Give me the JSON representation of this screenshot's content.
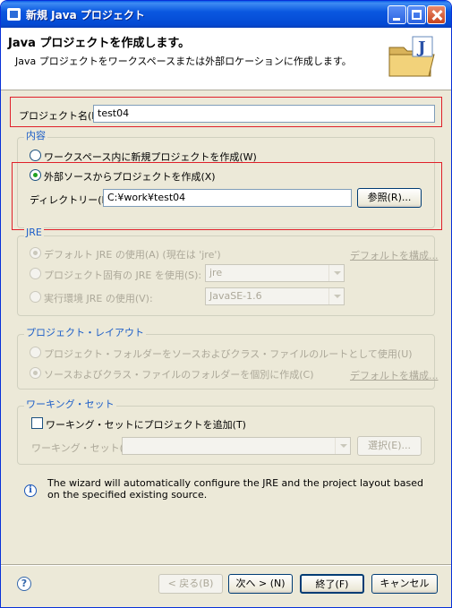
{
  "window": {
    "title": "新規 Java プロジェクト"
  },
  "banner": {
    "title": "Java プロジェクトを作成します。",
    "description": "Java プロジェクトをワークスペースまたは外部ロケーションに作成します。"
  },
  "project_name": {
    "label": "プロジェクト名(P):",
    "value": "test04"
  },
  "contents": {
    "title": "内容",
    "option_workspace": "ワークスペース内に新規プロジェクトを作成(W)",
    "option_external": "外部ソースからプロジェクトを作成(X)",
    "directory_label": "ディレクトリー(D):",
    "directory_value": "C:¥work¥test04",
    "browse_button": "参照(R)..."
  },
  "jre": {
    "title": "JRE",
    "option_default": "デフォルト JRE の使用(A) (現在は 'jre')",
    "default_link": "デフォルトを構成...",
    "option_project": "プロジェクト固有の JRE を使用(S):",
    "project_value": "jre",
    "option_env": "実行環境 JRE の使用(V):",
    "env_value": "JavaSE-1.6"
  },
  "layout": {
    "title": "プロジェクト・レイアウト",
    "option_root": "プロジェクト・フォルダーをソースおよびクラス・ファイルのルートとして使用(U)",
    "option_separate": "ソースおよびクラス・ファイルのフォルダーを個別に作成(C)",
    "default_link": "デフォルトを構成..."
  },
  "working_set": {
    "title": "ワーキング・セット",
    "add_label": "ワーキング・セットにプロジェクトを追加(T)",
    "set_label": "ワーキング・セット(O):",
    "select_button": "選択(E)..."
  },
  "info": {
    "message": "The wizard will automatically configure the JRE and the project layout based on the specified existing source."
  },
  "buttons": {
    "help_symbol": "?",
    "back": "< 戻る(B)",
    "next": "次へ > (N)",
    "finish": "終了(F)",
    "cancel": "キャンセル"
  },
  "icons": {
    "window_icon": "java-app-icon",
    "banner_icon": "java-project-folder-icon",
    "info_icon": "info-icon",
    "help_icon": "help-icon"
  },
  "colors": {
    "titlebar": "#0a58e0",
    "group_title": "#1c5ec8",
    "highlight_box": "#e0202a",
    "dialog_bg": "#ece9d8"
  }
}
